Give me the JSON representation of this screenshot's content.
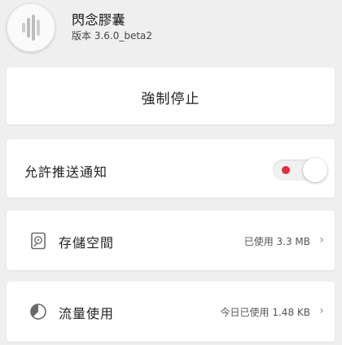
{
  "app": {
    "name": "閃念膠囊",
    "version": "版本 3.6.0_beta2",
    "logo_icon": "sound-wave-icon"
  },
  "actions": {
    "force_stop_label": "強制停止"
  },
  "notifications": {
    "label": "允許推送通知",
    "enabled": false,
    "indicator_color": "#e0303d"
  },
  "storage": {
    "label": "存儲空間",
    "value": "已使用 3.3 MB",
    "icon": "storage-icon"
  },
  "data_usage": {
    "label": "流量使用",
    "value": "今日已使用 1.48 KB",
    "icon": "pie-chart-icon"
  },
  "chevron": "›"
}
